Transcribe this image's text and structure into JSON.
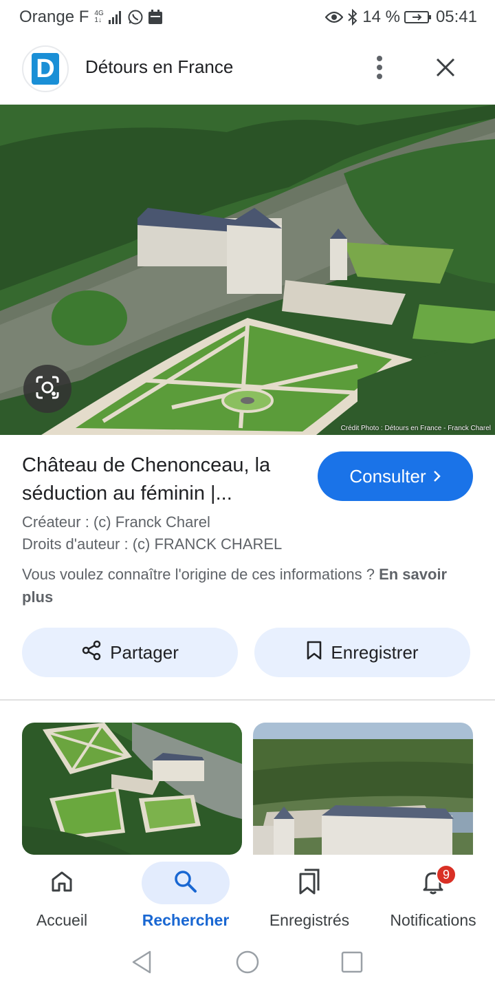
{
  "status_bar": {
    "carrier": "Orange F",
    "network_top": "4G",
    "network_bottom": "1↓",
    "battery": "14 %",
    "time": "05:41"
  },
  "header": {
    "logo_letter": "D",
    "site_name": "Détours en France",
    "more_icon": "more-vert-icon",
    "close_icon": "close-icon"
  },
  "hero": {
    "credit": "Crédit Photo : Détours en France - Franck Charel",
    "lens_icon": "lens-icon"
  },
  "result": {
    "title": "Château de Chenonceau, la séduction au féminin |...",
    "consult_label": "Consulter",
    "creator": "Créateur : (c) Franck Charel",
    "copyright": "Droits d'auteur : (c) FRANCK CHAREL",
    "origin_question": "Vous voulez connaître l'origine de ces informations ?",
    "learn_more": "En savoir plus"
  },
  "actions": {
    "share_label": "Partager",
    "save_label": "Enregistrer"
  },
  "bottom_nav": {
    "items": [
      {
        "label": "Accueil",
        "icon": "home-icon"
      },
      {
        "label": "Rechercher",
        "icon": "search-icon"
      },
      {
        "label": "Enregistrés",
        "icon": "bookmarks-icon"
      },
      {
        "label": "Notifications",
        "icon": "bell-icon",
        "badge": "9"
      }
    ],
    "active": "Rechercher"
  },
  "colors": {
    "accent": "#1a73e8",
    "chip_bg": "#e8f0fe",
    "badge": "#d93025"
  }
}
